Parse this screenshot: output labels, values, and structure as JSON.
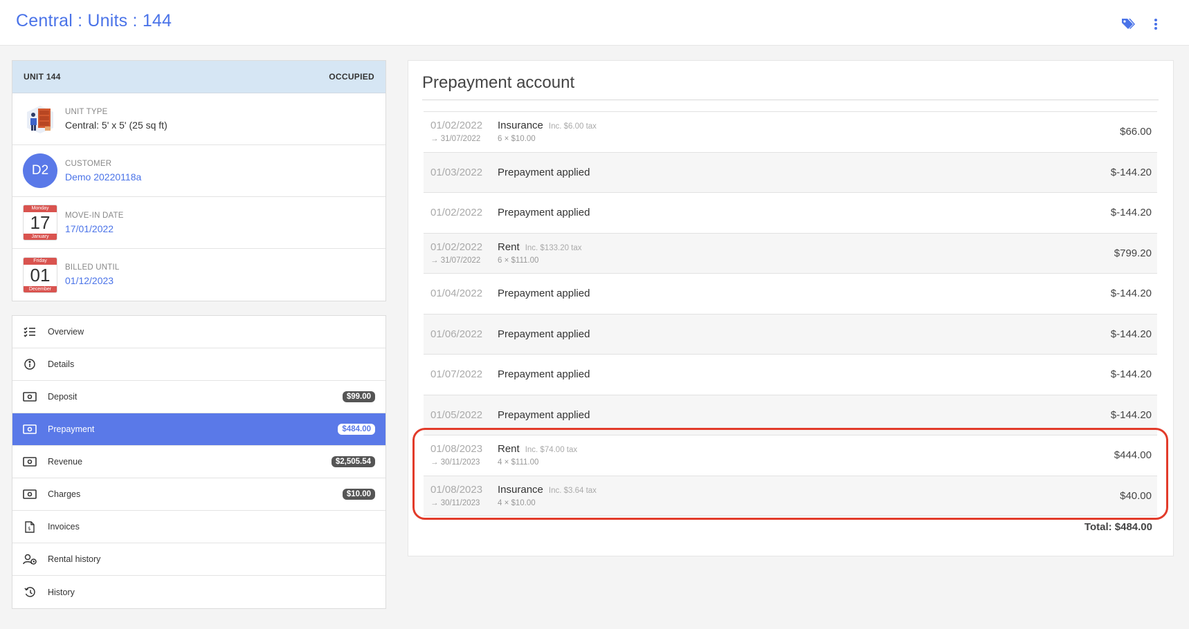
{
  "header": {
    "title": "Central : Units : 144",
    "icons": {
      "tags": "tags-icon",
      "more": "more-vertical-icon"
    }
  },
  "unit": {
    "name": "UNIT 144",
    "status": "OCCUPIED",
    "unit_type_label": "UNIT TYPE",
    "unit_type_value": "Central: 5' x 5' (25 sq ft)",
    "customer_label": "CUSTOMER",
    "customer_initials": "D2",
    "customer_value": "Demo 20220118a",
    "move_in_label": "MOVE-IN DATE",
    "move_in_value": "17/01/2022",
    "move_in_cal": {
      "weekday": "Monday",
      "day": "17",
      "month": "January"
    },
    "billed_label": "BILLED UNTIL",
    "billed_value": "01/12/2023",
    "billed_cal": {
      "weekday": "Friday",
      "day": "01",
      "month": "December"
    }
  },
  "nav": {
    "items": [
      {
        "label": "Overview",
        "icon": "checklist-icon",
        "badge": ""
      },
      {
        "label": "Details",
        "icon": "info-icon",
        "badge": ""
      },
      {
        "label": "Deposit",
        "icon": "money-icon",
        "badge": "$99.00"
      },
      {
        "label": "Prepayment",
        "icon": "money-icon",
        "badge": "$484.00",
        "active": true
      },
      {
        "label": "Revenue",
        "icon": "money-icon",
        "badge": "$2,505.54"
      },
      {
        "label": "Charges",
        "icon": "money-icon",
        "badge": "$10.00"
      },
      {
        "label": "Invoices",
        "icon": "invoice-icon",
        "badge": ""
      },
      {
        "label": "Rental history",
        "icon": "user-clock-icon",
        "badge": ""
      },
      {
        "label": "History",
        "icon": "history-icon",
        "badge": ""
      }
    ]
  },
  "account": {
    "title": "Prepayment account",
    "total": "Total: $484.00",
    "entries": [
      {
        "date": "01/02/2022",
        "sub_date": "→ 31/07/2022",
        "desc": "Insurance",
        "tax": "Inc. $6.00 tax",
        "detail": "6 × $10.00",
        "amount": "$66.00"
      },
      {
        "date": "01/03/2022",
        "sub_date": "",
        "desc": "Prepayment applied",
        "tax": "",
        "detail": "",
        "amount": "$-144.20"
      },
      {
        "date": "01/02/2022",
        "sub_date": "",
        "desc": "Prepayment applied",
        "tax": "",
        "detail": "",
        "amount": "$-144.20"
      },
      {
        "date": "01/02/2022",
        "sub_date": "→ 31/07/2022",
        "desc": "Rent",
        "tax": "Inc. $133.20 tax",
        "detail": "6 × $111.00",
        "amount": "$799.20"
      },
      {
        "date": "01/04/2022",
        "sub_date": "",
        "desc": "Prepayment applied",
        "tax": "",
        "detail": "",
        "amount": "$-144.20"
      },
      {
        "date": "01/06/2022",
        "sub_date": "",
        "desc": "Prepayment applied",
        "tax": "",
        "detail": "",
        "amount": "$-144.20"
      },
      {
        "date": "01/07/2022",
        "sub_date": "",
        "desc": "Prepayment applied",
        "tax": "",
        "detail": "",
        "amount": "$-144.20"
      },
      {
        "date": "01/05/2022",
        "sub_date": "",
        "desc": "Prepayment applied",
        "tax": "",
        "detail": "",
        "amount": "$-144.20"
      },
      {
        "date": "01/08/2023",
        "sub_date": "→ 30/11/2023",
        "desc": "Rent",
        "tax": "Inc. $74.00 tax",
        "detail": "4 × $111.00",
        "amount": "$444.00"
      },
      {
        "date": "01/08/2023",
        "sub_date": "→ 30/11/2023",
        "desc": "Insurance",
        "tax": "Inc. $3.64 tax",
        "detail": "4 × $10.00",
        "amount": "$40.00"
      }
    ]
  },
  "colors": {
    "accent": "#5a79e8",
    "title": "#4a73e8",
    "highlight": "#e23b2a",
    "header_bg": "#d6e6f4"
  }
}
